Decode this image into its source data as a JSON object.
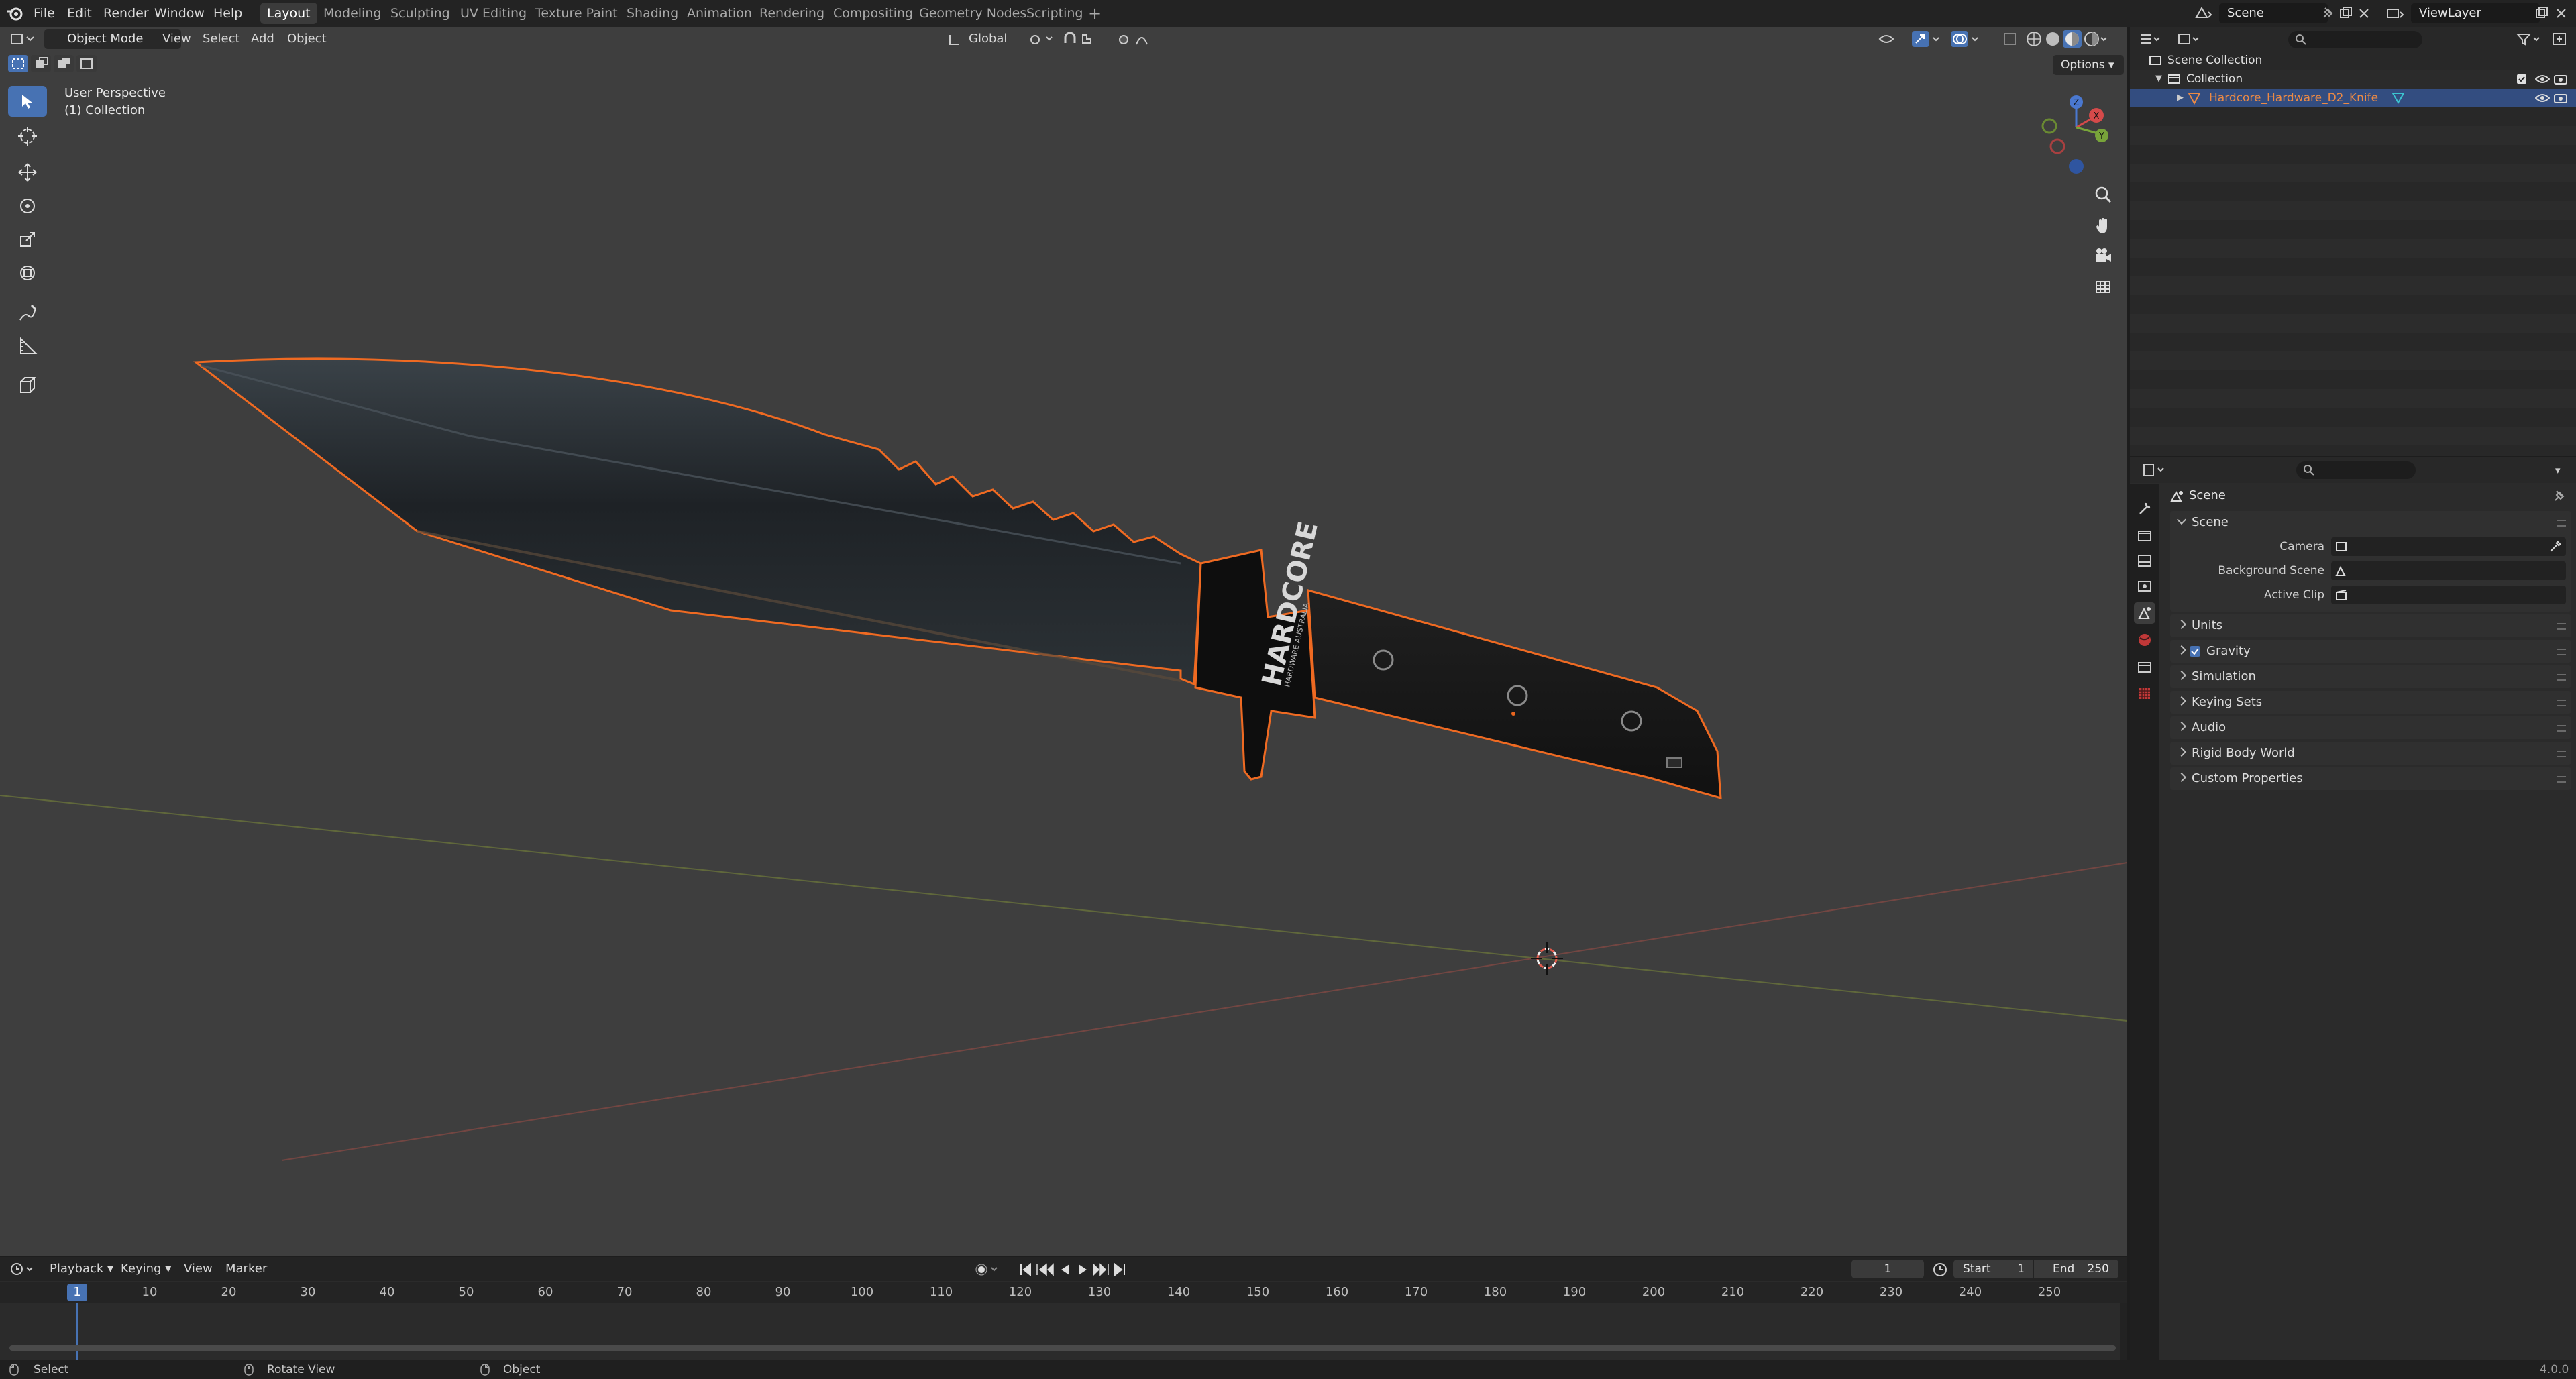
{
  "menu": {
    "items": [
      "File",
      "Edit",
      "Render",
      "Window",
      "Help"
    ]
  },
  "workspaces": [
    "Layout",
    "Modeling",
    "Sculpting",
    "UV Editing",
    "Texture Paint",
    "Shading",
    "Animation",
    "Rendering",
    "Compositing",
    "Geometry Nodes",
    "Scripting"
  ],
  "active_workspace": "Layout",
  "scene_field": "Scene",
  "viewlayer_field": "ViewLayer",
  "viewport": {
    "mode": "Object Mode",
    "menus": [
      "View",
      "Select",
      "Add",
      "Object"
    ],
    "transform_orientation": "Global",
    "options_label": "Options",
    "overlay_title": "User Perspective",
    "overlay_subtitle": "(1) Collection",
    "gizmo_axes": [
      "Z",
      "X",
      "Y"
    ],
    "blade_text": "HARDCORE",
    "blade_subtext": "HARDWARE AUSTRALIA",
    "accent_selection": "#e8651f"
  },
  "outliner": {
    "root": "Scene Collection",
    "collection": "Collection",
    "object": "Hardcore_Hardware_D2_Knife",
    "object_color": "#ec8a45"
  },
  "properties": {
    "context_title": "Scene",
    "panel_scene": "Scene",
    "camera_label": "Camera",
    "background_scene_label": "Background Scene",
    "active_clip_label": "Active Clip",
    "panels": [
      "Units",
      "Gravity",
      "Simulation",
      "Keying Sets",
      "Audio",
      "Rigid Body World",
      "Custom Properties"
    ],
    "gravity_checked": true
  },
  "timeline": {
    "menus": [
      "Playback",
      "Keying",
      "View",
      "Marker"
    ],
    "current_frame": "1",
    "start_label": "Start",
    "start_value": "1",
    "end_label": "End",
    "end_value": "250",
    "ticks": [
      "1",
      "10",
      "20",
      "30",
      "40",
      "50",
      "60",
      "70",
      "80",
      "90",
      "100",
      "110",
      "120",
      "130",
      "140",
      "150",
      "160",
      "170",
      "180",
      "190",
      "200",
      "210",
      "220",
      "230",
      "240",
      "250"
    ]
  },
  "status": {
    "select": "Select",
    "rotate": "Rotate View",
    "object": "Object",
    "version": "4.0.0"
  }
}
